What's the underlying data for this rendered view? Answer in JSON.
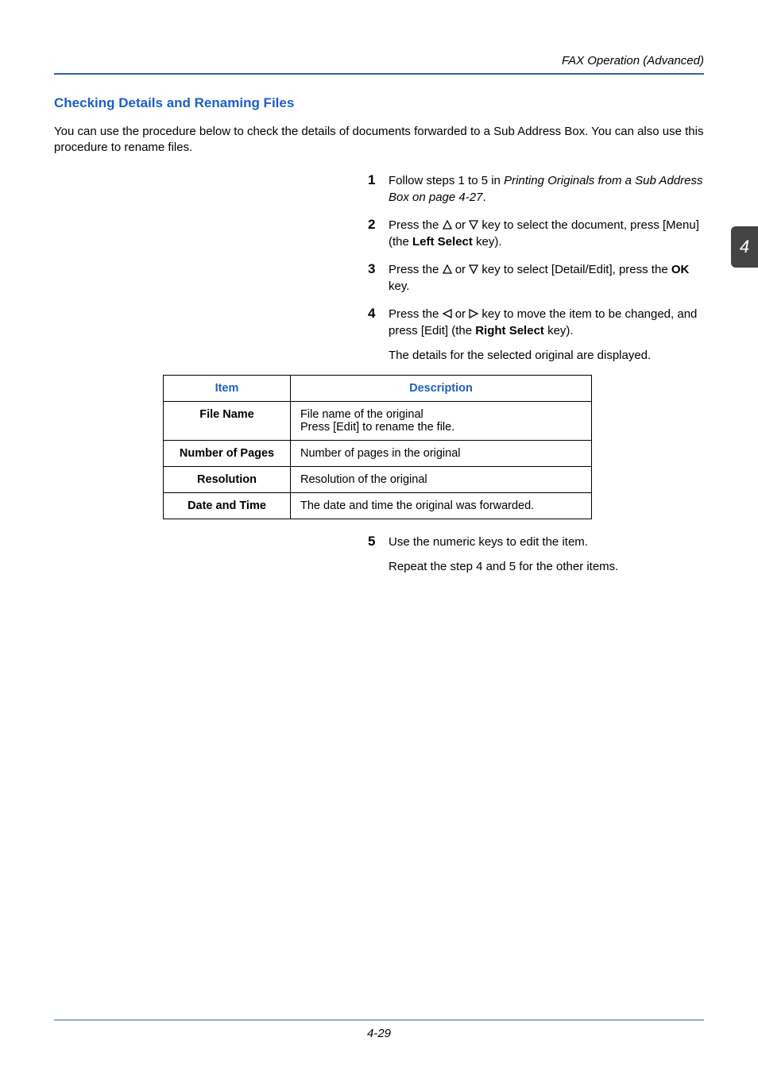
{
  "header": {
    "section": "FAX Operation (Advanced)"
  },
  "side_tab": "4",
  "title": "Checking Details and Renaming Files",
  "intro": "You can use the procedure below to check the details of documents forwarded to a Sub Address Box. You can also use this procedure to rename files.",
  "steps": {
    "s1a": "Follow steps 1 to 5 in ",
    "s1b": "Printing Originals from a Sub Address Box on page 4-27",
    "s1c": ".",
    "s2a": "Press the ",
    "s2b": " or ",
    "s2c": " key to select the document, press [Menu] (the ",
    "s2d": "Left Select",
    "s2e": " key).",
    "s3a": "Press the ",
    "s3b": " or ",
    "s3c": " key to select [Detail/Edit], press  the ",
    "s3d": "OK",
    "s3e": " key.",
    "s4a": "Press the ",
    "s4b": " or ",
    "s4c": " key to move the item to be changed, and press [Edit] (the ",
    "s4d": "Right Select",
    "s4e": " key).",
    "s4sub": "The details for the selected original are displayed.",
    "s5a": "Use the numeric keys to edit the item.",
    "s5sub": "Repeat the step 4 and 5 for the other items."
  },
  "table": {
    "h_item": "Item",
    "h_desc": "Description",
    "r1_item": "File Name",
    "r1_desc": "File name of the original\nPress [Edit] to rename the file.",
    "r2_item": "Number of Pages",
    "r2_desc": "Number of pages in the original",
    "r3_item": "Resolution",
    "r3_desc": "Resolution of the original",
    "r4_item": "Date and Time",
    "r4_desc": "The date and time the original was forwarded."
  },
  "footer": {
    "page": "4-29"
  }
}
